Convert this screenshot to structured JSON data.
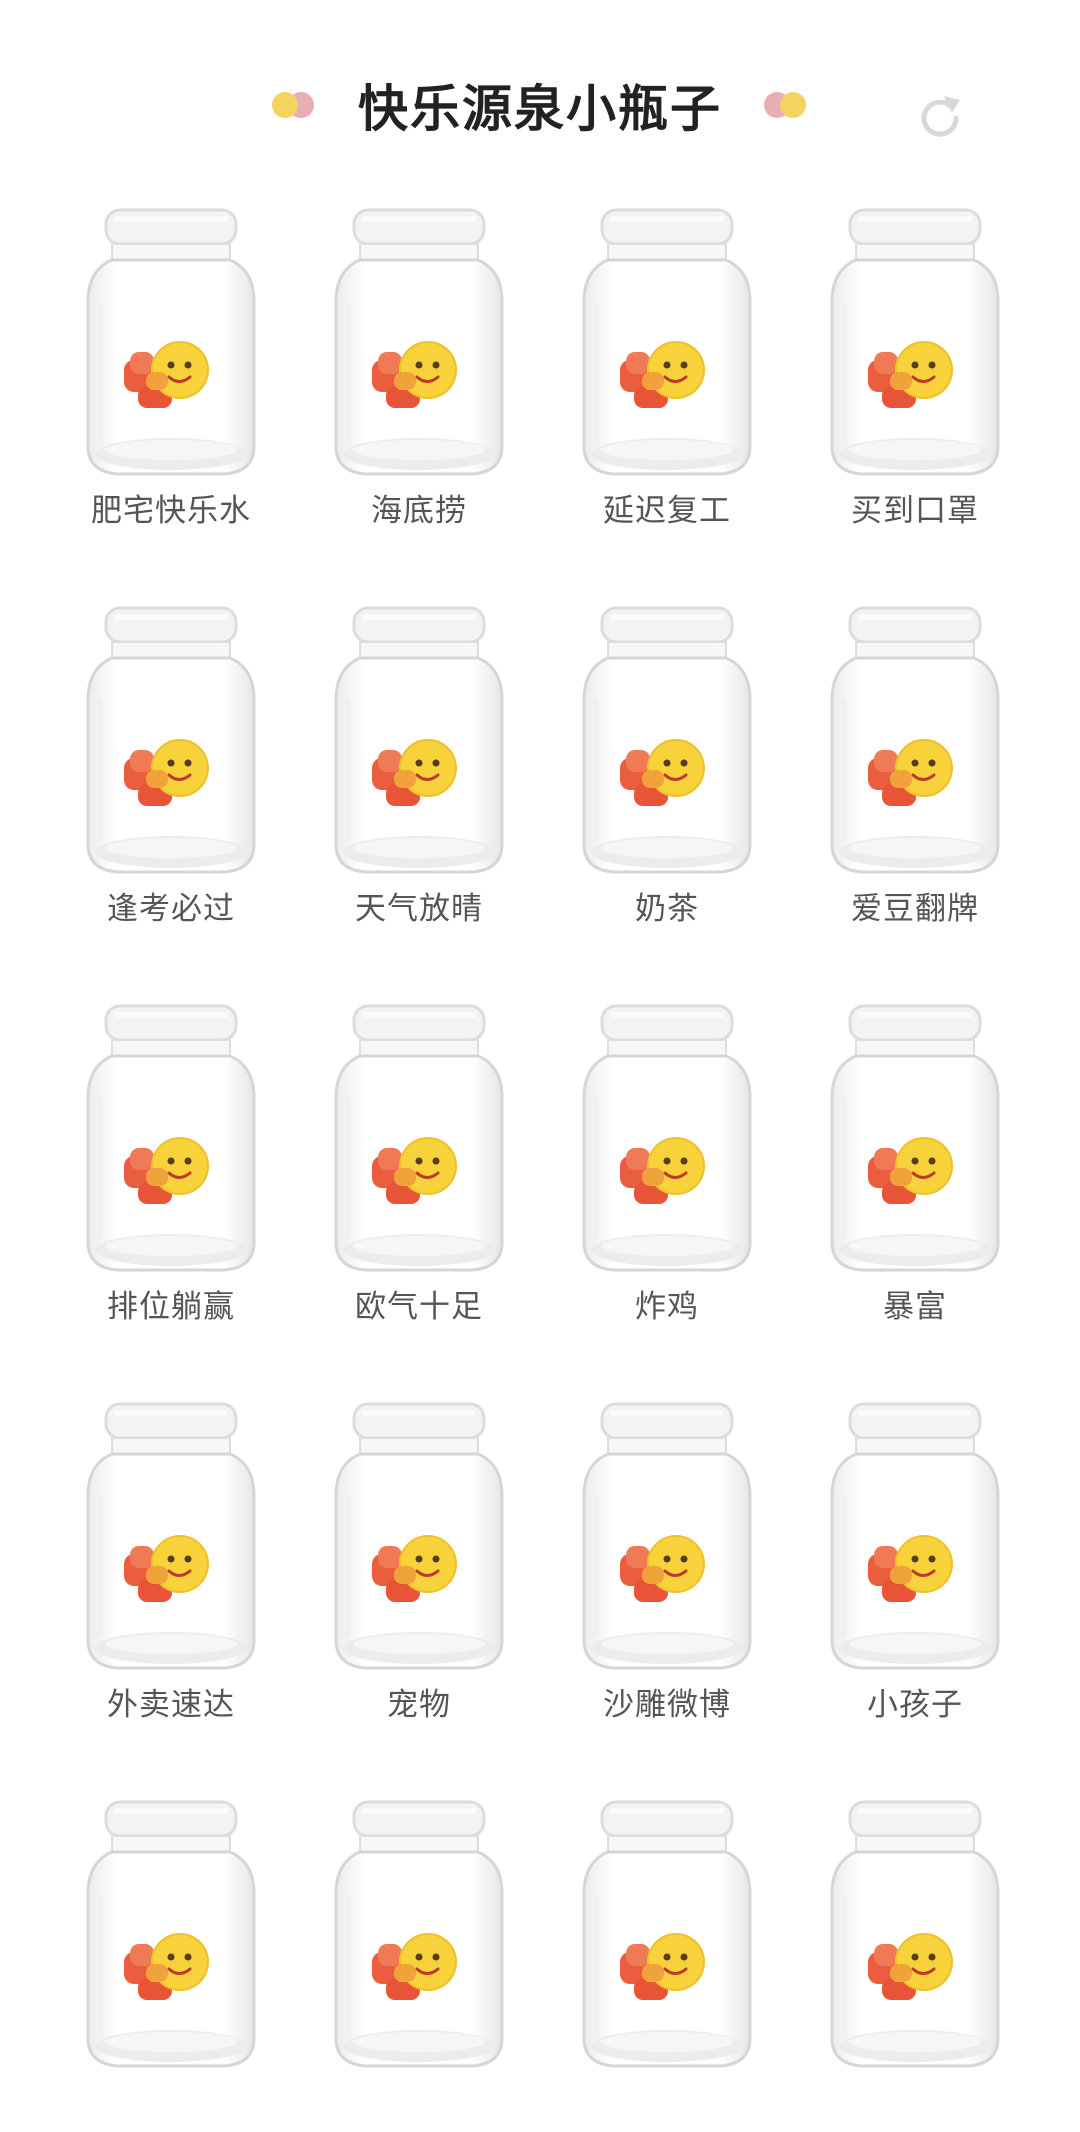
{
  "header": {
    "title": "快乐源泉小瓶子",
    "refresh_icon": "refresh-icon"
  },
  "colors": {
    "dot_yellow": "#f4d35e",
    "dot_pink": "#e9aeb4",
    "title_text": "#222222",
    "label_text": "#555555"
  },
  "jars": [
    {
      "label": "肥宅快乐水"
    },
    {
      "label": "海底捞"
    },
    {
      "label": "延迟复工"
    },
    {
      "label": "买到口罩"
    },
    {
      "label": "逢考必过"
    },
    {
      "label": "天气放晴"
    },
    {
      "label": "奶茶"
    },
    {
      "label": "爱豆翻牌"
    },
    {
      "label": "排位躺赢"
    },
    {
      "label": "欧气十足"
    },
    {
      "label": "炸鸡"
    },
    {
      "label": "暴富"
    },
    {
      "label": "外卖速达"
    },
    {
      "label": "宠物"
    },
    {
      "label": "沙雕微博"
    },
    {
      "label": "小孩子"
    },
    {
      "label": ""
    },
    {
      "label": ""
    },
    {
      "label": ""
    },
    {
      "label": ""
    }
  ]
}
